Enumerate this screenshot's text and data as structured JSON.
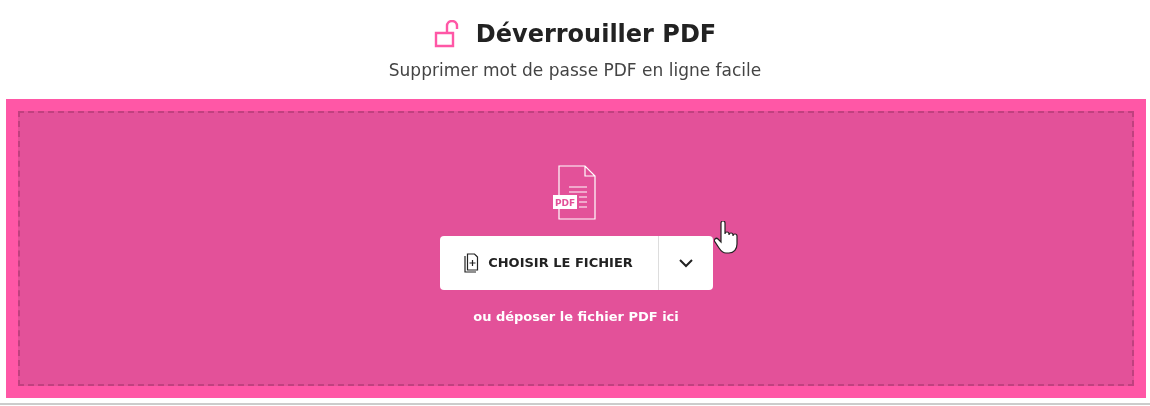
{
  "header": {
    "title": "Déverrouiller PDF",
    "subtitle": "Supprimer mot de passe PDF en ligne facile"
  },
  "dropzone": {
    "file_badge": "PDF",
    "button": "CHOISIR LE FICHIER",
    "hint": "ou déposer le fichier PDF ici"
  }
}
